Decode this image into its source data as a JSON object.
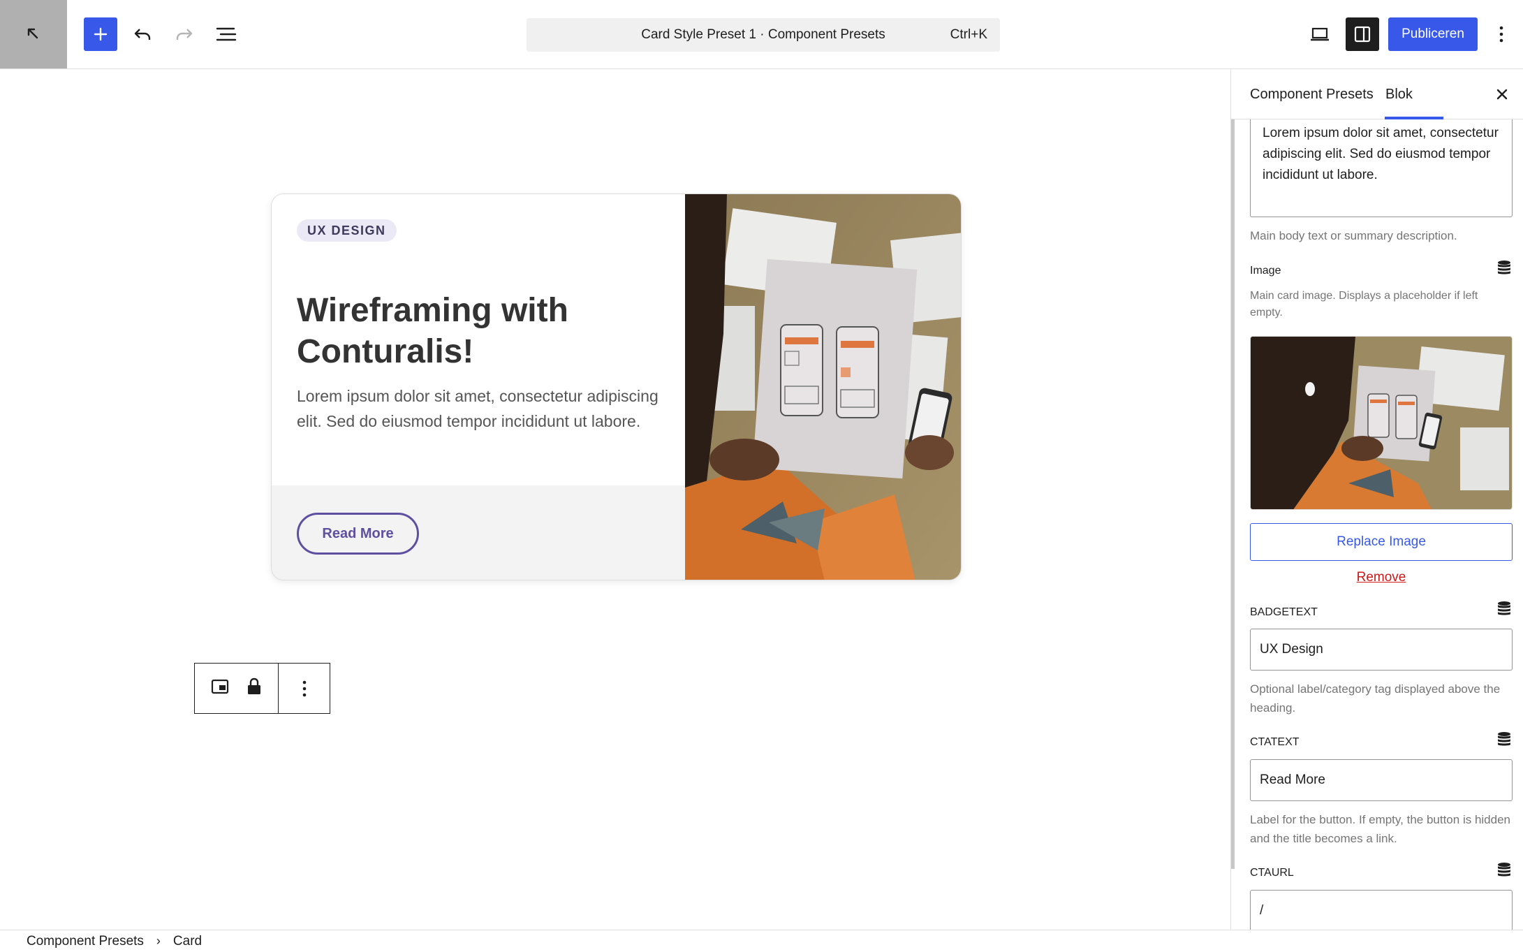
{
  "toolbar": {
    "document_title": "Card Style Preset 1 · Component Presets",
    "shortcut": "Ctrl+K",
    "publish_label": "Publiceren"
  },
  "card": {
    "badge": "UX DESIGN",
    "title": "Wireframing with Conturalis!",
    "text": "Lorem ipsum dolor sit amet, consectetur adipiscing elit. Sed do eiusmod tempor incididunt ut labore.",
    "cta": "Read More"
  },
  "breadcrumb": {
    "items": [
      "Component Presets",
      "Card"
    ]
  },
  "sidebar": {
    "tabs": [
      "Component Presets",
      "Blok"
    ],
    "active_tab": "Blok",
    "text_value": "Lorem ipsum dolor sit amet, consectetur adipiscing elit. Sed do eiusmod tempor incididunt ut labore.",
    "text_help": "Main body text or summary description.",
    "image_label": "Image",
    "image_help": "Main card image. Displays a placeholder if left empty.",
    "replace_label": "Replace Image",
    "remove_label": "Remove",
    "badgetext_label": "BADGETEXT",
    "badgetext_value": "UX Design",
    "badgetext_help": "Optional label/category tag displayed above the heading.",
    "ctatext_label": "CTATEXT",
    "ctatext_value": "Read More",
    "ctatext_help": "Label for the button. If empty, the button is hidden and the title becomes a link.",
    "ctaurl_label": "CTAURL",
    "ctaurl_value": "/"
  },
  "colors": {
    "accent": "#3858e9",
    "cta_purple": "#5f4fa0",
    "remove_red": "#cc1818"
  }
}
